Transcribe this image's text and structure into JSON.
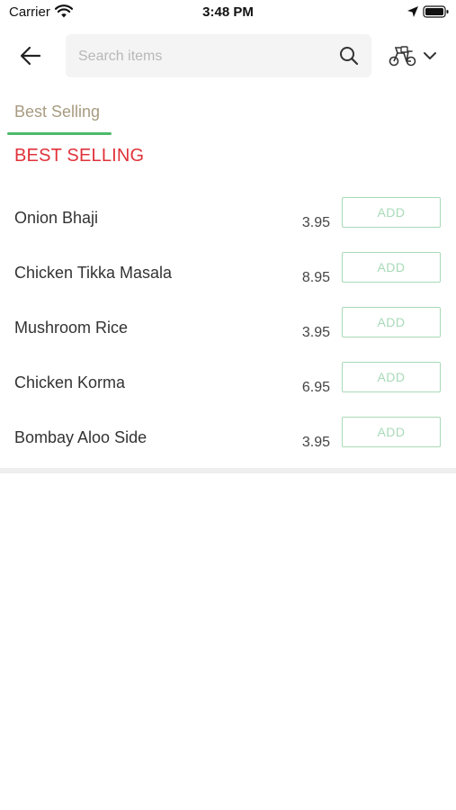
{
  "status_bar": {
    "carrier": "Carrier",
    "time": "3:48 PM"
  },
  "search": {
    "placeholder": "Search items",
    "value": ""
  },
  "tabs": [
    {
      "label": "Best Selling",
      "active": true
    }
  ],
  "section": {
    "title": "BEST SELLING"
  },
  "items": [
    {
      "name": "Onion Bhaji",
      "price": "3.95",
      "button": "ADD"
    },
    {
      "name": "Chicken Tikka Masala",
      "price": "8.95",
      "button": "ADD"
    },
    {
      "name": "Mushroom Rice",
      "price": "3.95",
      "button": "ADD"
    },
    {
      "name": "Chicken Korma",
      "price": "6.95",
      "button": "ADD"
    },
    {
      "name": "Bombay Aloo Side",
      "price": "3.95",
      "button": "ADD"
    }
  ],
  "colors": {
    "accent_green": "#4dbb6a",
    "section_red": "#e0323a",
    "tab_text": "#a89b80",
    "add_button": "#a8dab8"
  },
  "icons": {
    "back": "back-arrow-icon",
    "search": "search-icon",
    "delivery": "scooter-icon",
    "dropdown": "chevron-down-icon"
  }
}
